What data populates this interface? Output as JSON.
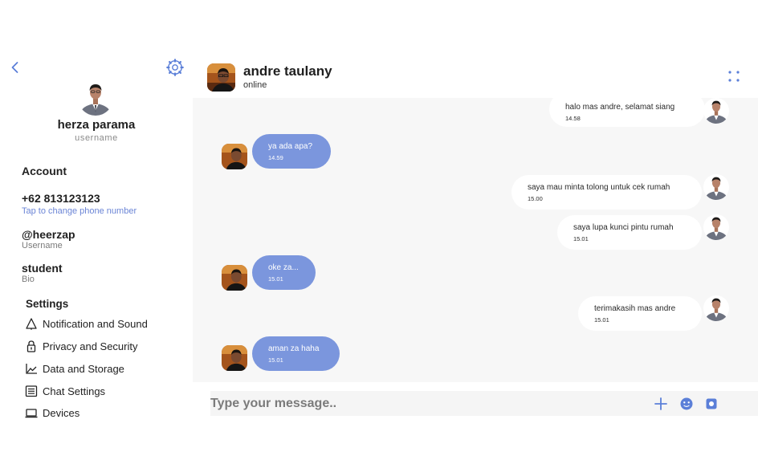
{
  "profile": {
    "name": "herza parama",
    "username_label": "username"
  },
  "account": {
    "title": "Account",
    "phone": "+62 813123123",
    "phone_hint": "Tap to change phone number",
    "handle": "@heerzap",
    "handle_label": "Username",
    "bio": "student",
    "bio_label": "Bio"
  },
  "settings": {
    "title": "Settings",
    "items": [
      {
        "label": "Notification and Sound",
        "icon": "bell-icon"
      },
      {
        "label": "Privacy and Security",
        "icon": "lock-icon"
      },
      {
        "label": "Data and Storage",
        "icon": "chart-icon"
      },
      {
        "label": "Chat Settings",
        "icon": "chat-settings-icon"
      },
      {
        "label": "Devices",
        "icon": "laptop-icon"
      }
    ]
  },
  "chat": {
    "contact_name": "andre taulany",
    "contact_status": "online",
    "messages": [
      {
        "direction": "out",
        "text": "halo mas andre, selamat siang",
        "time": "14.58"
      },
      {
        "direction": "in",
        "text": "ya ada apa?",
        "time": "14.59"
      },
      {
        "direction": "out",
        "text": "saya mau minta tolong untuk cek rumah",
        "time": "15.00"
      },
      {
        "direction": "out",
        "text": "saya lupa kunci pintu rumah",
        "time": "15.01"
      },
      {
        "direction": "in",
        "text": "oke za...",
        "time": "15.01"
      },
      {
        "direction": "out",
        "text": "terimakasih mas andre",
        "time": "15.01"
      },
      {
        "direction": "in",
        "text": "aman za haha",
        "time": "15.01"
      }
    ]
  },
  "composer": {
    "placeholder": "Type your message.."
  },
  "colors": {
    "accent": "#7b96dd",
    "icon_blue": "#5b7fd8",
    "chat_bg": "#f7f7f7"
  }
}
